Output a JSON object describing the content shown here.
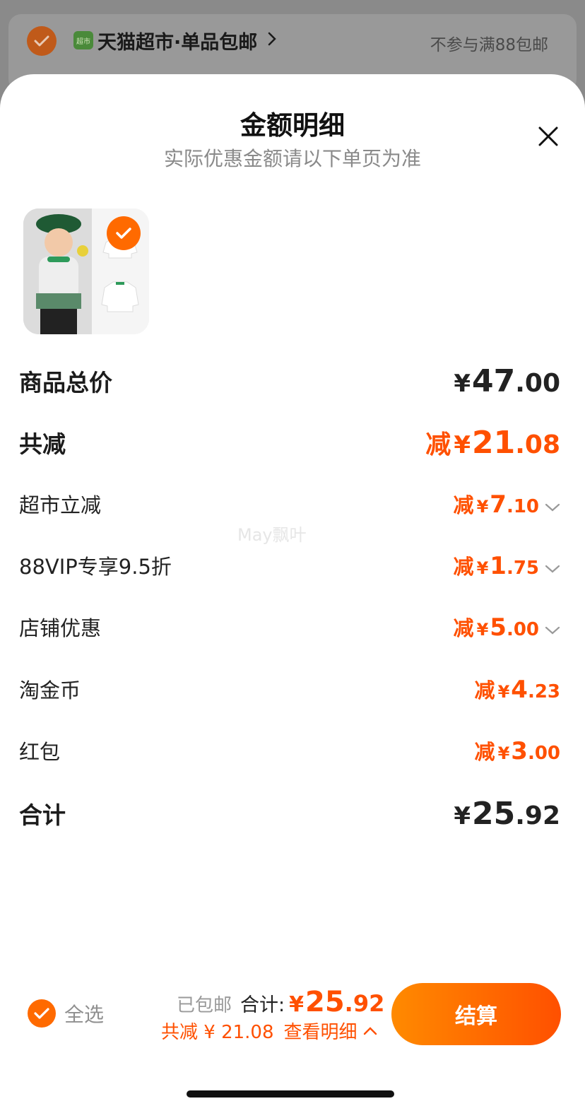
{
  "background_cart": {
    "store_icon_text": "超市",
    "store_name": "天猫超市·单品包邮",
    "promo_note": "不参与满88包邮"
  },
  "sheet": {
    "title": "金额明细",
    "subtitle": "实际优惠金额请以下单页为准",
    "watermark": "May飘叶"
  },
  "details": {
    "subtotal": {
      "label": "商品总价",
      "yen": "¥",
      "int": "47",
      "dec": ".00"
    },
    "total_discount": {
      "label": "共减",
      "prefix": "减",
      "yen": "¥",
      "int": "21",
      "dec": ".08"
    },
    "items": [
      {
        "label": "超市立减",
        "prefix": "减",
        "yen": "¥",
        "int": "7",
        "dec": ".10",
        "expandable": true
      },
      {
        "label": "88VIP专享9.5折",
        "prefix": "减",
        "yen": "¥",
        "int": "1",
        "dec": ".75",
        "expandable": true
      },
      {
        "label": "店铺优惠",
        "prefix": "减",
        "yen": "¥",
        "int": "5",
        "dec": ".00",
        "expandable": true
      },
      {
        "label": "淘金币",
        "prefix": "减",
        "yen": "¥",
        "int": "4",
        "dec": ".23",
        "expandable": false
      },
      {
        "label": "红包",
        "prefix": "减",
        "yen": "¥",
        "int": "3",
        "dec": ".00",
        "expandable": false
      }
    ],
    "total": {
      "label": "合计",
      "yen": "¥",
      "int": "25",
      "dec": ".92"
    }
  },
  "bottom_bar": {
    "select_all": "全选",
    "free_shipping": "已包邮",
    "total_label": "合计:",
    "total_yen": "¥",
    "total_int": "25",
    "total_dec": ".92",
    "saving_text": "共减 ¥ 21.08",
    "view_detail": "查看明细",
    "checkout": "结算"
  },
  "colors": {
    "accent": "#ff5000",
    "check": "#ff6a00"
  }
}
